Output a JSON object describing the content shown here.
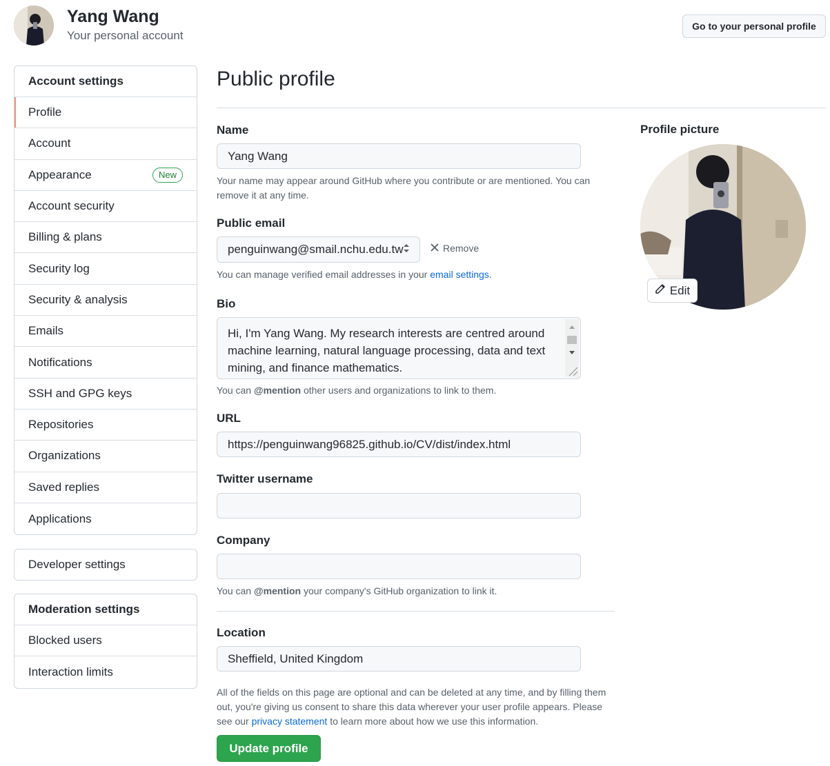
{
  "header": {
    "name": "Yang Wang",
    "subtitle": "Your personal account",
    "profile_button": "Go to your personal profile"
  },
  "sidebar": {
    "account_settings": {
      "heading": "Account settings",
      "items": [
        {
          "label": "Profile",
          "selected": true
        },
        {
          "label": "Account"
        },
        {
          "label": "Appearance",
          "badge": "New"
        },
        {
          "label": "Account security"
        },
        {
          "label": "Billing & plans"
        },
        {
          "label": "Security log"
        },
        {
          "label": "Security & analysis"
        },
        {
          "label": "Emails"
        },
        {
          "label": "Notifications"
        },
        {
          "label": "SSH and GPG keys"
        },
        {
          "label": "Repositories"
        },
        {
          "label": "Organizations"
        },
        {
          "label": "Saved replies"
        },
        {
          "label": "Applications"
        }
      ]
    },
    "developer_settings": "Developer settings",
    "moderation": {
      "heading": "Moderation settings",
      "items": [
        {
          "label": "Blocked users"
        },
        {
          "label": "Interaction limits"
        }
      ]
    }
  },
  "main": {
    "title": "Public profile",
    "name": {
      "label": "Name",
      "value": "Yang Wang",
      "note": "Your name may appear around GitHub where you contribute or are mentioned. You can remove it at any time."
    },
    "email": {
      "label": "Public email",
      "value": "penguinwang@smail.nchu.edu.tw",
      "remove": "Remove",
      "note_prefix": "You can manage verified email addresses in your",
      "note_link": "email settings",
      "note_suffix": "."
    },
    "bio": {
      "label": "Bio",
      "value": "Hi, I'm Yang Wang. My research interests are centred around machine learning, natural language processing, data and text mining, and finance mathematics.",
      "note_prefix": "You can",
      "note_mention": "@mention",
      "note_suffix": "other users and organizations to link to them."
    },
    "url": {
      "label": "URL",
      "value": "https://penguinwang96825.github.io/CV/dist/index.html"
    },
    "twitter": {
      "label": "Twitter username",
      "value": ""
    },
    "company": {
      "label": "Company",
      "value": "",
      "note_prefix": "You can",
      "note_mention": "@mention",
      "note_suffix": "your company's GitHub organization to link it."
    },
    "location": {
      "label": "Location",
      "value": "Sheffield, United Kingdom"
    },
    "footer": {
      "text_prefix": "All of the fields on this page are optional and can be deleted at any time, and by filling them out, you're giving us consent to share this data wherever your user profile appears. Please see our",
      "link": "privacy statement",
      "text_suffix": "to learn more about how we use this information."
    },
    "update_button": "Update profile"
  },
  "profile_picture": {
    "label": "Profile picture",
    "edit_button": "Edit"
  },
  "colors": {
    "accent_green": "#2da44e",
    "link_blue": "#0969da",
    "selected_marker": "#fd8c73"
  }
}
